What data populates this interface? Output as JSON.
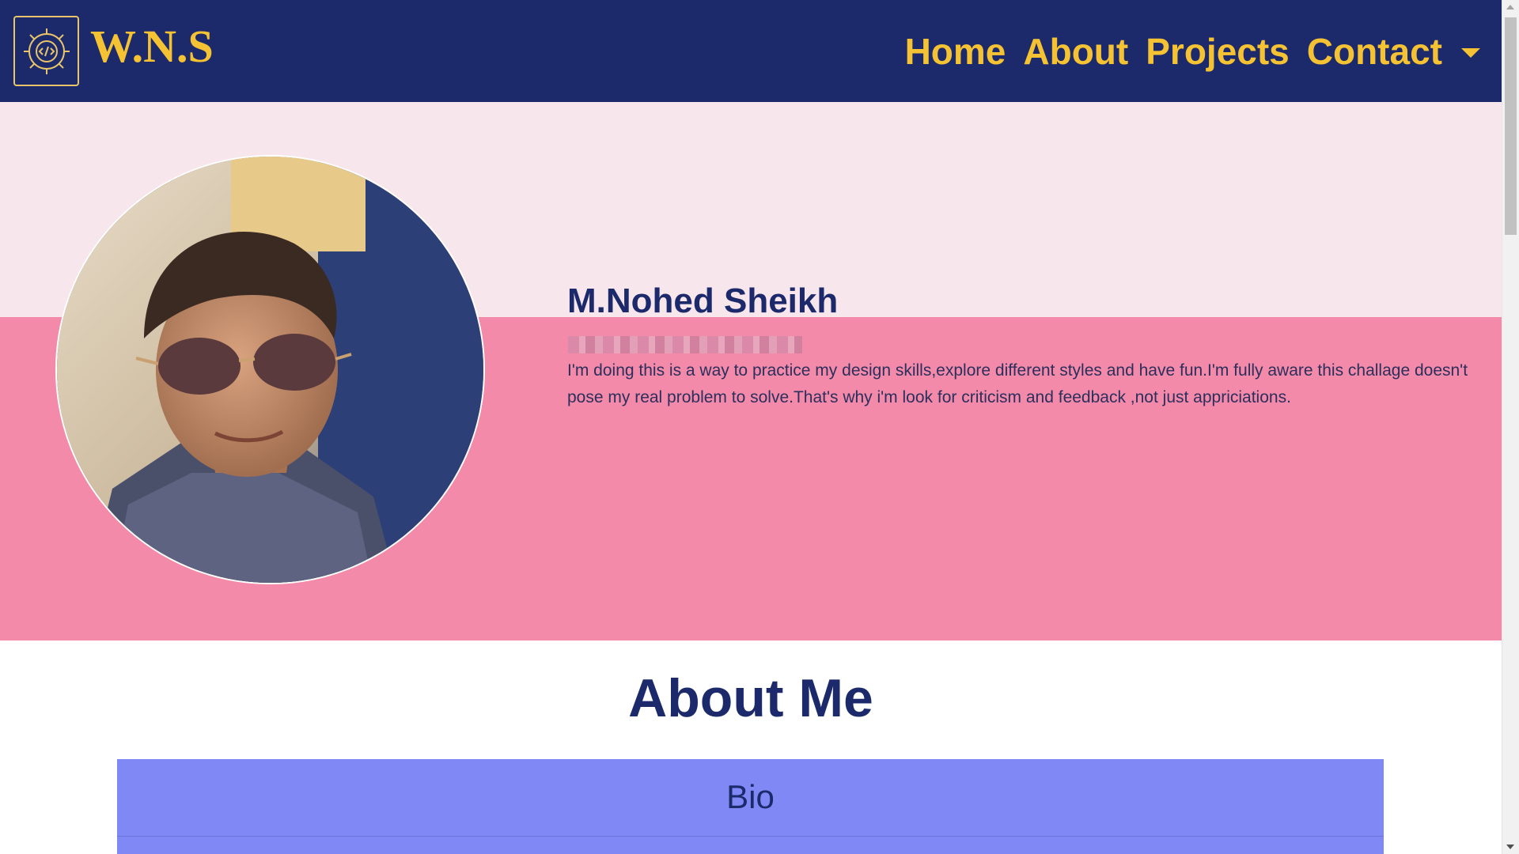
{
  "navbar": {
    "brand": "W.N.S",
    "links": [
      {
        "label": "Home"
      },
      {
        "label": "About"
      },
      {
        "label": "Projects"
      },
      {
        "label": "Contact"
      }
    ]
  },
  "profile": {
    "name": "M.Nohed Sheikh",
    "description": "I'm doing this is a way to practice my design skills,explore different styles and have fun.I'm fully aware this challage doesn't pose my real problem to solve.That's why i'm look for criticism and feedback ,not just appriciations."
  },
  "about": {
    "title": "About Me",
    "bio_title": "Bio"
  },
  "colors": {
    "navbar": "#1c2a6b",
    "accent": "#f4c233",
    "hero_top": "#f7e6ec",
    "hero_bottom": "#f48aaa",
    "bio_card": "#8088f5"
  },
  "icons": [
    "gear-code-logo-icon",
    "chevron-down-icon"
  ]
}
